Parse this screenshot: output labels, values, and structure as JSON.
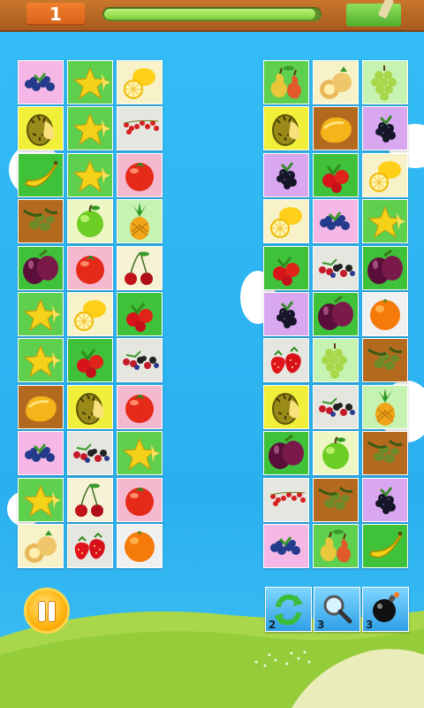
{
  "header": {
    "level": "1",
    "time_remaining_fraction": 0.98
  },
  "board": {
    "left": [
      [
        "blueberry",
        "starfruit",
        "lemon"
      ],
      [
        "durian",
        "starfruit",
        "redcurrant"
      ],
      [
        "banana",
        "starfruit",
        "tomato"
      ],
      [
        "olive",
        "apple",
        "pineapple"
      ],
      [
        "plum",
        "tomato",
        "cherry"
      ],
      [
        "starfruit",
        "lemon",
        "rosehip"
      ],
      [
        "starfruit",
        "rosehip",
        "berrymix"
      ],
      [
        "mango",
        "durian",
        "tomato"
      ],
      [
        "blueberry",
        "berrymix",
        "starfruit"
      ],
      [
        "starfruit",
        "cherry",
        "tomato"
      ],
      [
        "kiwano",
        "strawberry",
        "orange"
      ]
    ],
    "right": [
      [
        "pear",
        "kiwano",
        "grape"
      ],
      [
        "durian",
        "mango",
        "blackberry"
      ],
      [
        "blackberry",
        "rosehip",
        "lemon"
      ],
      [
        "lemon",
        "blueberry",
        "starfruit"
      ],
      [
        "rosehip",
        "berrymix",
        "plum"
      ],
      [
        "blackberry",
        "plum",
        "orange"
      ],
      [
        "strawberry",
        "grape",
        "olive"
      ],
      [
        "durian",
        "berrymix",
        "pineapple"
      ],
      [
        "plum",
        "apple",
        "olive"
      ],
      [
        "redcurrant",
        "olive",
        "blackberry"
      ],
      [
        "blueberry",
        "pear",
        "banana"
      ]
    ],
    "tile_backgrounds": {
      "blueberry": "#f5b7e6",
      "starfruit": "#5fcf4e",
      "lemon": "#f7f2c8",
      "durian": "#f2ef3a",
      "redcurrant": "#e6e6e0",
      "banana": "#3fc23a",
      "tomato": "#f5b9cf",
      "olive": "#b36a1f",
      "apple": "#eef7c4",
      "pineapple": "#c7f3b2",
      "plum": "#3fc23a",
      "cherry": "#f7f2d5",
      "rosehip": "#3fc23a",
      "berrymix": "#e6e6e0",
      "mango": "#b36a1f",
      "kiwano": "#f7f2c8",
      "strawberry": "#e6e6e0",
      "orange": "#f0f0f0",
      "pear": "#5fcf4e",
      "grape": "#c7f3b2",
      "blackberry": "#d9a7f0"
    }
  },
  "controls": {
    "pause_icon": "pause-icon",
    "tools": [
      {
        "name": "shuffle",
        "icon": "shuffle-icon",
        "count": "2"
      },
      {
        "name": "hint",
        "icon": "magnifier-icon",
        "count": "3"
      },
      {
        "name": "bomb",
        "icon": "bomb-icon",
        "count": "3"
      }
    ]
  }
}
